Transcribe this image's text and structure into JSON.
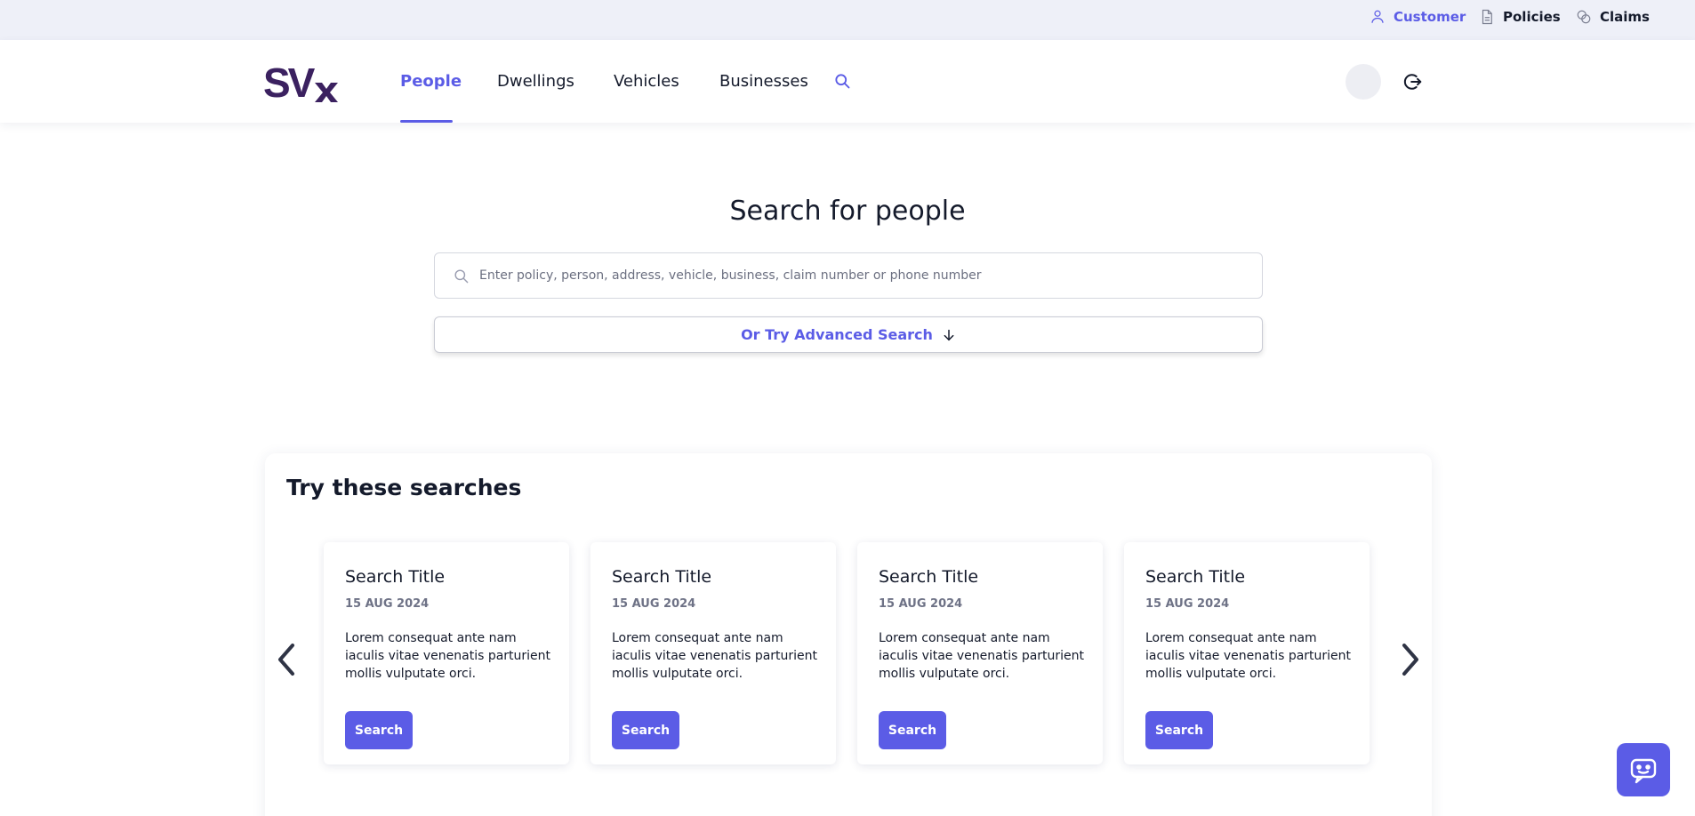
{
  "utilbar": {
    "items": [
      {
        "label": "Customer",
        "icon": "user-icon",
        "active": true
      },
      {
        "label": "Policies",
        "icon": "document-icon",
        "active": false
      },
      {
        "label": "Claims",
        "icon": "coins-icon",
        "active": false
      }
    ]
  },
  "header": {
    "logo_text": "SVx",
    "nav": [
      {
        "label": "People",
        "active": true
      },
      {
        "label": "Dwellings",
        "active": false
      },
      {
        "label": "Vehicles",
        "active": false
      },
      {
        "label": "Businesses",
        "active": false
      }
    ],
    "icons": [
      "search-icon",
      "avatar",
      "logout-icon"
    ]
  },
  "search": {
    "title": "Search for people",
    "placeholder": "Enter policy, person, address, vehicle, business, claim number or phone number",
    "value": "",
    "advanced_label": "Or Try Advanced Search"
  },
  "suggestions": {
    "title": "Try these searches",
    "cards": [
      {
        "title": "Search Title",
        "date": "15 AUG 2024",
        "body": "Lorem consequat ante nam iaculis vitae venenatis parturient mollis vulputate orci.",
        "button": "Search"
      },
      {
        "title": "Search Title",
        "date": "15 AUG 2024",
        "body": "Lorem consequat ante nam iaculis vitae venenatis parturient mollis vulputate orci.",
        "button": "Search"
      },
      {
        "title": "Search Title",
        "date": "15 AUG 2024",
        "body": "Lorem consequat ante nam iaculis vitae venenatis parturient mollis vulputate orci.",
        "button": "Search"
      },
      {
        "title": "Search Title",
        "date": "15 AUG 2024",
        "body": "Lorem consequat ante nam iaculis vitae venenatis parturient mollis vulputate orci.",
        "button": "Search"
      }
    ]
  },
  "colors": {
    "accent": "#5b5ce6",
    "text": "#141a2b",
    "muted": "#6e7286",
    "utilbar_bg": "#eef0f8",
    "logo": "#3b2160"
  }
}
